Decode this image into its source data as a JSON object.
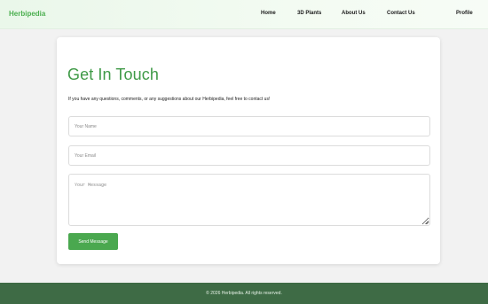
{
  "navbar": {
    "brand": "Herbipedia",
    "links": [
      {
        "label": "Home"
      },
      {
        "label": "3D Plants"
      },
      {
        "label": "About Us"
      },
      {
        "label": "Contact Us"
      },
      {
        "label": "Profile"
      }
    ]
  },
  "contact": {
    "title": "Get In Touch",
    "intro": "If you have any questions, comments, or any suggestions about our Herbipedia, feel free to contact us!",
    "name_placeholder": "Your Name",
    "email_placeholder": "Your Email",
    "message_placeholder": "Your Message",
    "submit_label": "Send Message"
  },
  "footer": {
    "text": "© 2026 Herbipedia. All rights reserved."
  },
  "colors": {
    "brand_green": "#4caf50",
    "title_green": "#3f9a47",
    "button_green": "#4aa84f",
    "footer_bg": "#3e6b45"
  }
}
